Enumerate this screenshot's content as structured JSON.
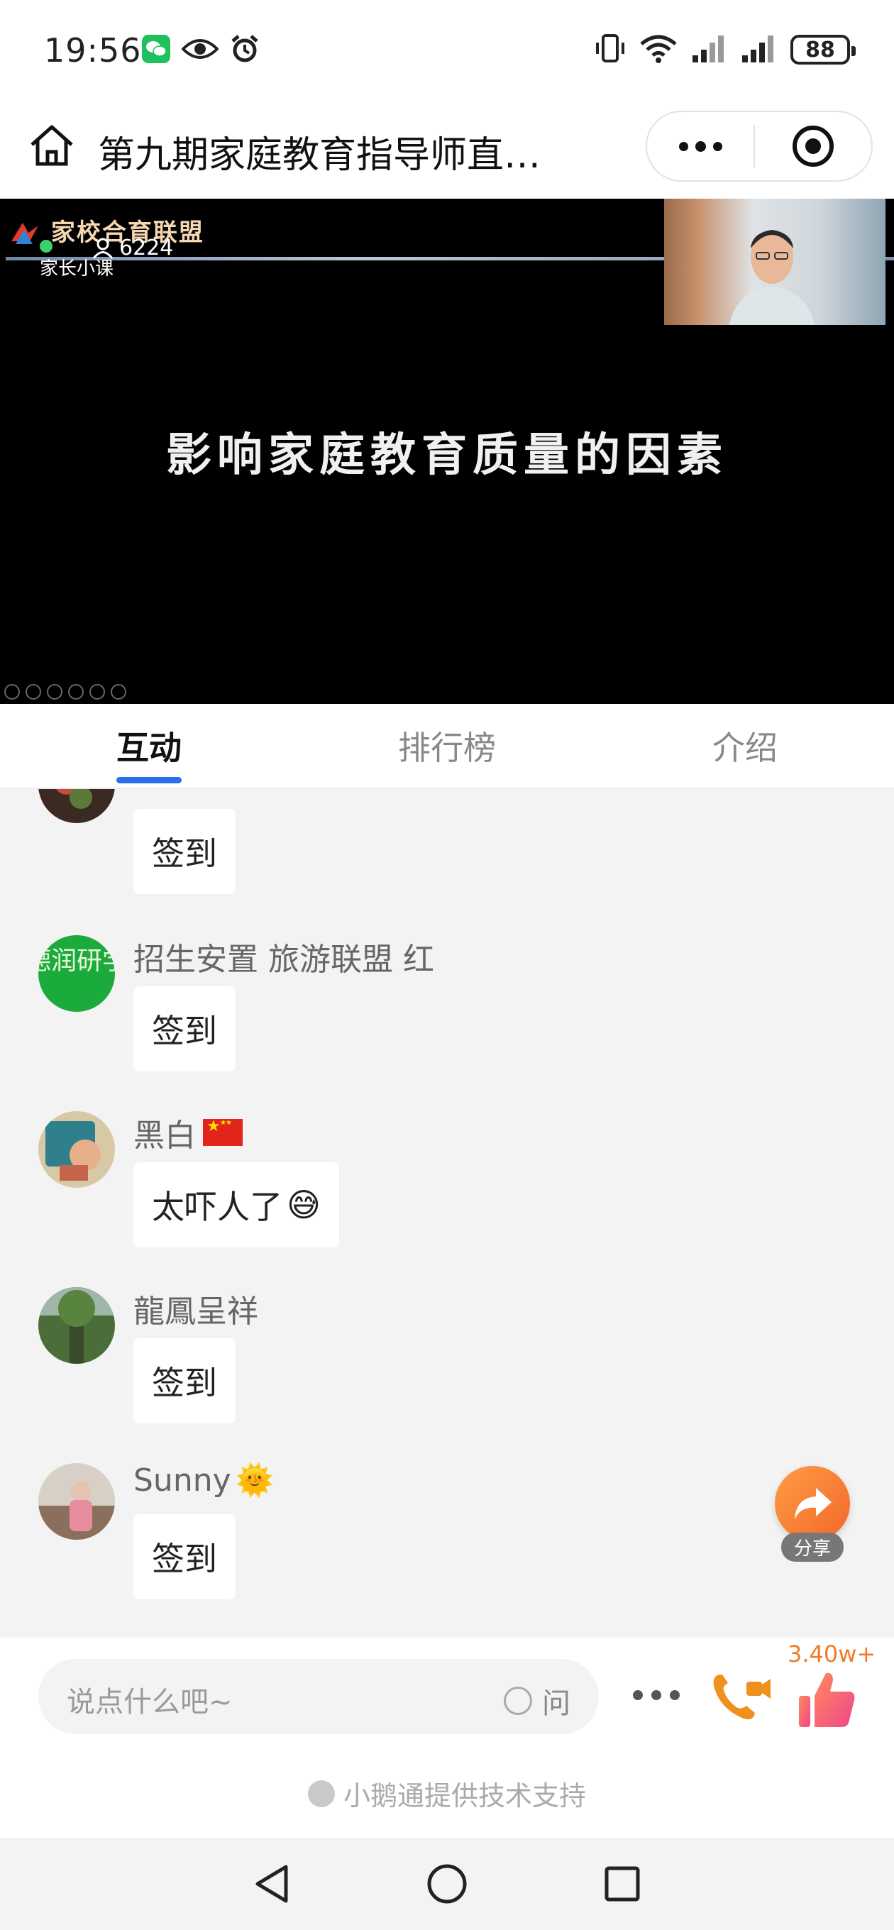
{
  "status_bar": {
    "time": "19:56",
    "battery": "88"
  },
  "header": {
    "title": "第九期家庭教育指导师直…"
  },
  "video": {
    "logo_text": "家校合育联盟",
    "logo_sub": "家长小课",
    "viewers": "6224",
    "slide_heading": "影响家庭教育质量的因素"
  },
  "tabs": [
    {
      "label": "互动",
      "active": true
    },
    {
      "label": "排行榜",
      "active": false
    },
    {
      "label": "介绍",
      "active": false
    }
  ],
  "messages": [
    {
      "nickname": "",
      "text": "签到"
    },
    {
      "nickname": "招生安置 旅游联盟 红",
      "text": "签到",
      "avatar_text": "德润研学"
    },
    {
      "nickname": "黑白",
      "text": "太吓人了",
      "emoji": "😅"
    },
    {
      "nickname": "龍鳳呈祥",
      "text": "签到"
    },
    {
      "nickname": "Sunny",
      "text": "签到",
      "name_emoji": "🌞"
    }
  ],
  "share": {
    "label": "分享"
  },
  "input": {
    "placeholder": "说点什么吧~",
    "ask_label": "问"
  },
  "likes": {
    "count": "3.40w+"
  },
  "footer": {
    "powered_by": "小鹅通提供技术支持"
  },
  "colors": {
    "accent_blue": "#2a6fea",
    "share_orange": "#f2672a",
    "like_count_orange": "#f07b2a"
  }
}
